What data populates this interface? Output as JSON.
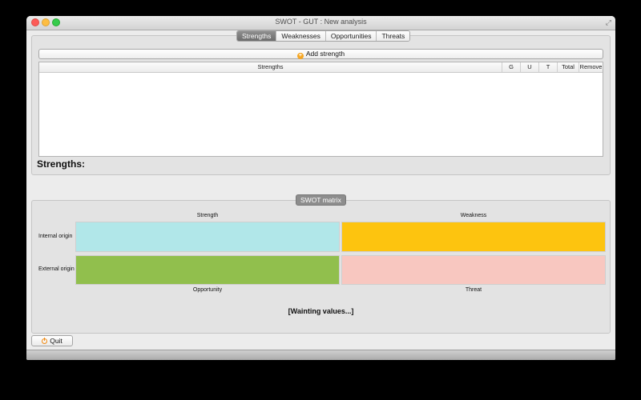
{
  "window": {
    "title": "SWOT - GUT : New analysis"
  },
  "tabs": [
    "Strengths",
    "Weaknesses",
    "Opportunities",
    "Threats"
  ],
  "strengths_panel": {
    "add_button_label": "Add strength",
    "columns": [
      "Strengths",
      "G",
      "U",
      "T",
      "Total",
      "Remove"
    ],
    "heading": "Strengths:"
  },
  "matrix": {
    "badge": "SWOT matrix",
    "column_labels": {
      "strength": "Strength",
      "weakness": "Weakness",
      "opportunity": "Opportunity",
      "threat": "Threat"
    },
    "row_labels": {
      "internal": "Internal origin",
      "external": "External origin"
    },
    "colors": {
      "strength": "#b1e7e9",
      "weakness": "#fdc40f",
      "opportunity": "#91bf4d",
      "threat": "#f8c7c0"
    },
    "status": "[Wainting values...]"
  },
  "quit_button_label": "Quit"
}
